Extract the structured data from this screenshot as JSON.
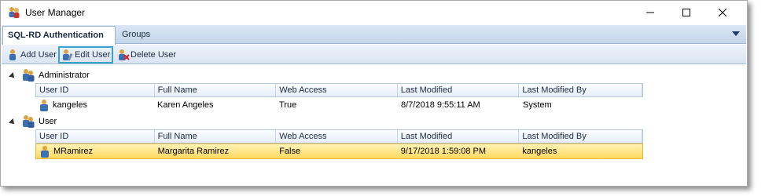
{
  "window": {
    "title": "User Manager",
    "app_icon": "users-icon",
    "controls": {
      "minimize": "minimize-icon",
      "maximize": "maximize-icon",
      "close": "close-icon"
    }
  },
  "tabs": [
    {
      "label": "SQL-RD Authentication",
      "active": true
    },
    {
      "label": "Groups",
      "active": false
    }
  ],
  "toolbar": {
    "add_label": "Add User",
    "edit_label": "Edit User",
    "delete_label": "Delete User"
  },
  "columns": [
    "User ID",
    "Full Name",
    "Web Access",
    "Last Modified",
    "Last Modified By"
  ],
  "groups": [
    {
      "name": "Administrator",
      "rows": [
        {
          "user_id": "kangeles",
          "full_name": "Karen Angeles",
          "web_access": "True",
          "last_modified": "8/7/2018 9:55:11 AM",
          "last_modified_by": "System",
          "selected": false
        }
      ]
    },
    {
      "name": "User",
      "rows": [
        {
          "user_id": "MRamirez",
          "full_name": "Margarita Ramirez",
          "web_access": "False",
          "last_modified": "9/17/2018 1:59:08 PM",
          "last_modified_by": "kangeles",
          "selected": true
        }
      ]
    }
  ],
  "colors": {
    "accent": "#3aa3c8",
    "selection": "#ffd85e",
    "tab_bg": "#c4d5ea"
  }
}
